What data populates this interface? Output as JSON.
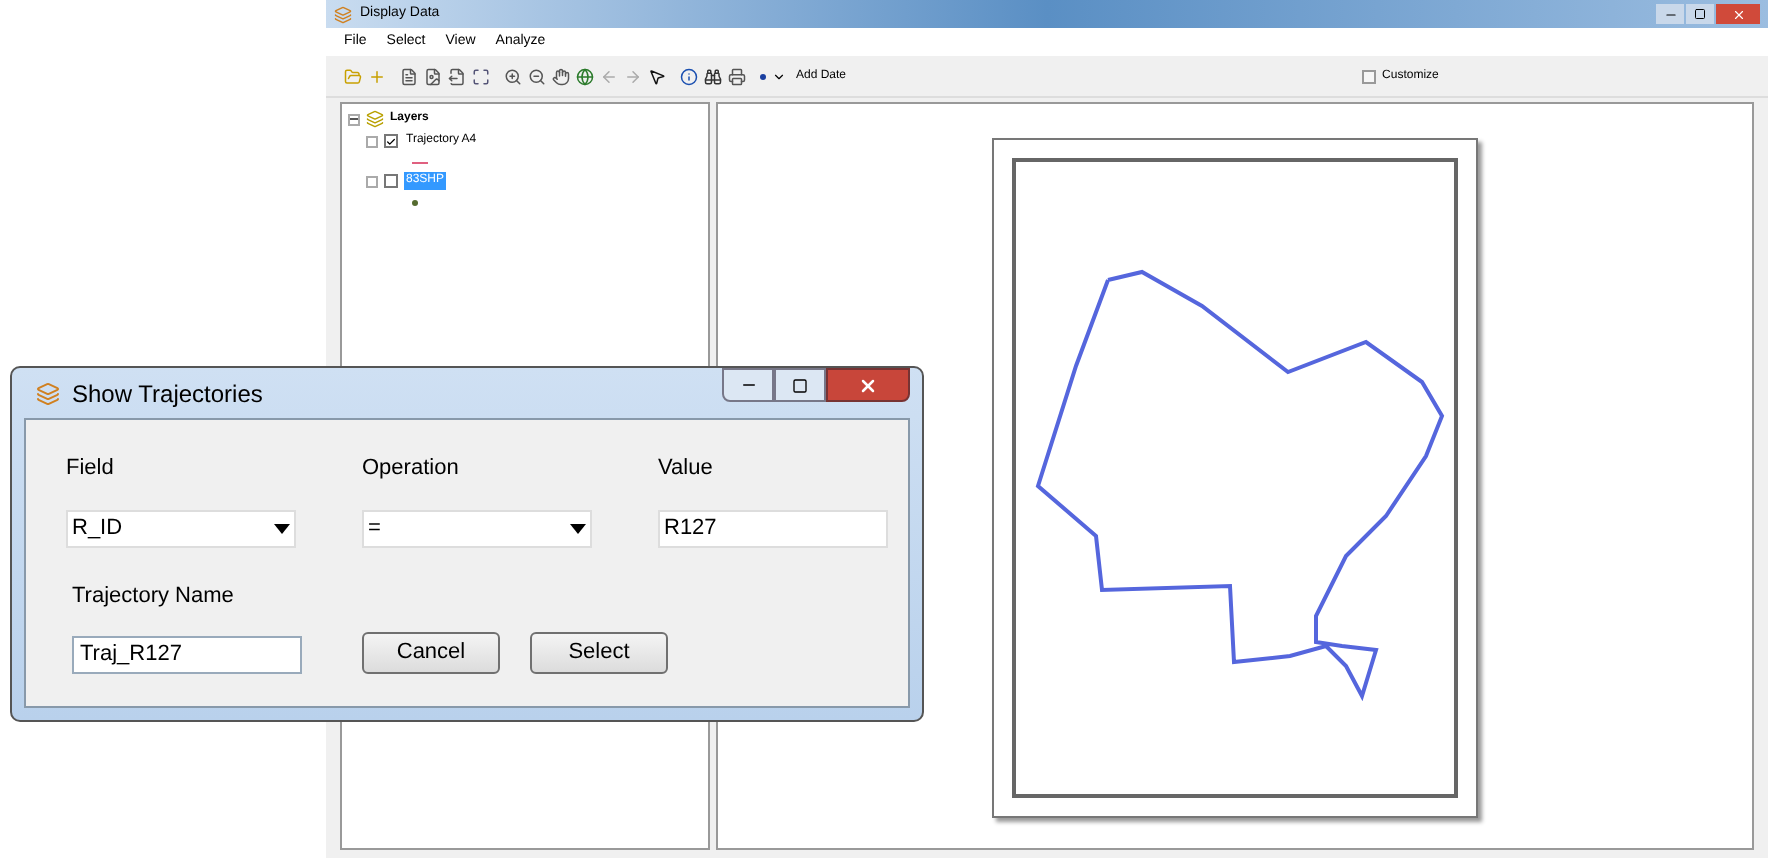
{
  "window": {
    "title": "Display Data"
  },
  "menu": [
    "File",
    "Select",
    "View",
    "Analyze"
  ],
  "toolbar": {
    "add_label": "Add Date",
    "customize": {
      "label": "Customize",
      "checked": false
    }
  },
  "layers": {
    "label": "Layers",
    "expanded": true,
    "children": [
      {
        "label": "Trajectory A4",
        "kind": "line",
        "checked": true,
        "selected": false,
        "color": "#e06080"
      },
      {
        "label": "83SHP",
        "kind": "point",
        "checked": false,
        "selected": true,
        "color": "#556b2f"
      }
    ]
  },
  "dialog": {
    "title": "Show Trajectories",
    "fields": [
      {
        "label": "Field",
        "value": "R_ID",
        "kind": "dropdown"
      },
      {
        "label": "Operation",
        "value": "=",
        "kind": "dropdown"
      },
      {
        "label": "Value",
        "value": "R127",
        "kind": "text"
      }
    ],
    "name_field": {
      "label": "Trajectory Name",
      "value": "Traj_R127"
    },
    "buttons": [
      "Cancel",
      "Select"
    ]
  }
}
